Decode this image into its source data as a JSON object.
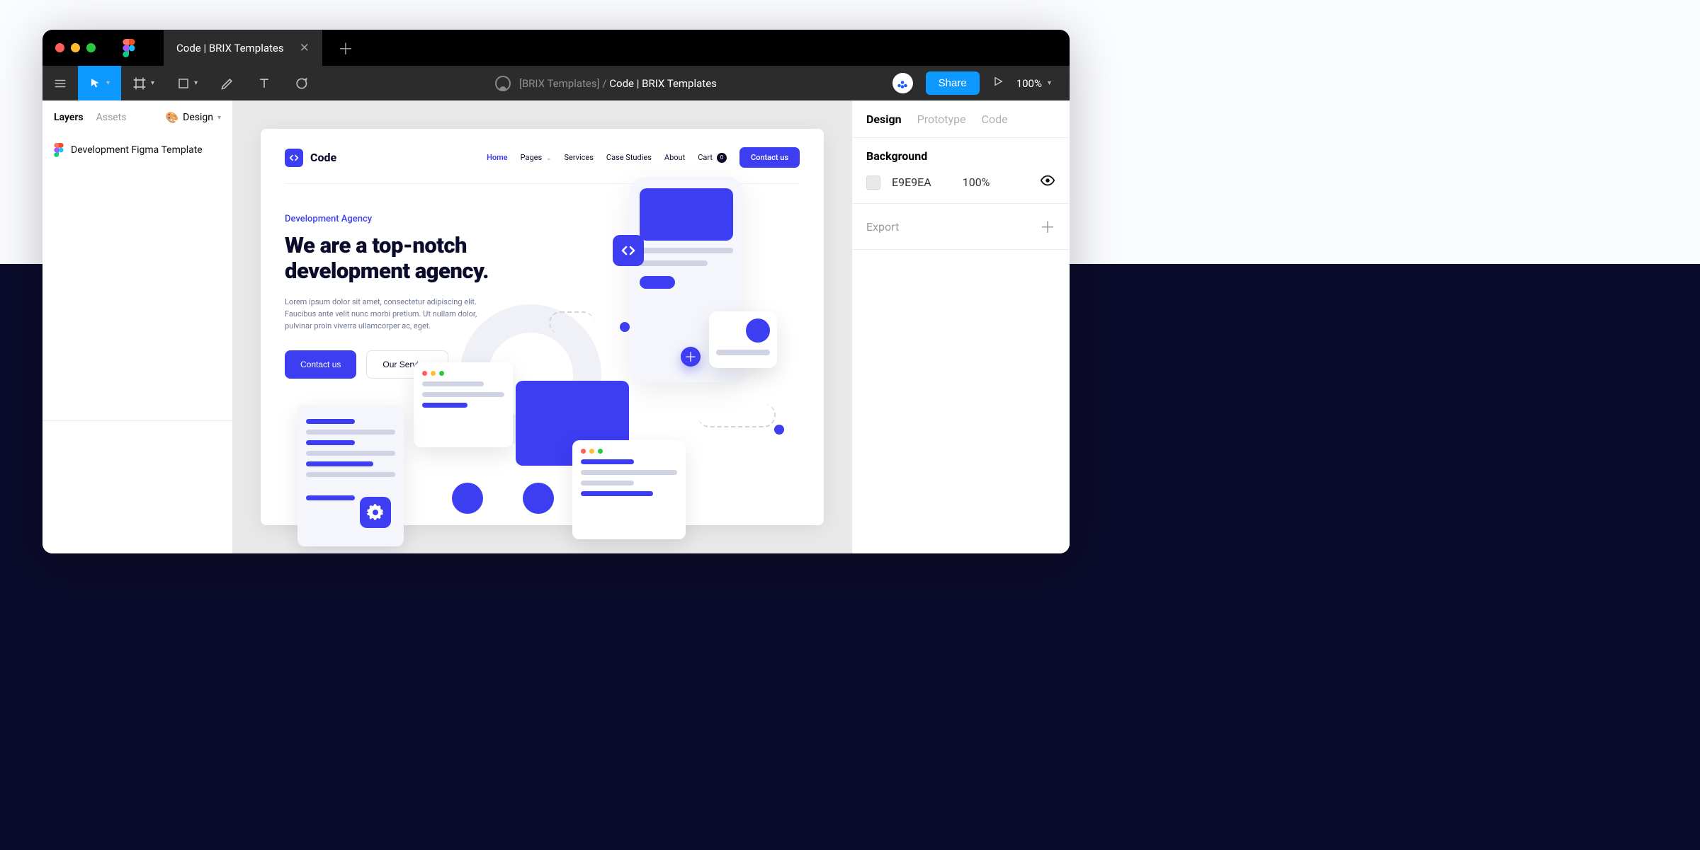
{
  "tab": {
    "title": "Code | BRIX Templates"
  },
  "breadcrumb": {
    "team": "[BRIX Templates]",
    "sep": "/",
    "file": "Code | BRIX Templates"
  },
  "toolbar": {
    "share": "Share",
    "zoom": "100%"
  },
  "left_panel": {
    "tabs": {
      "layers": "Layers",
      "assets": "Assets",
      "design": "Design"
    },
    "layer_name": "Development Figma Template"
  },
  "right_panel": {
    "tabs": {
      "design": "Design",
      "prototype": "Prototype",
      "code": "Code"
    },
    "bg_heading": "Background",
    "bg_hex": "E9E9EA",
    "bg_opacity": "100%",
    "export": "Export"
  },
  "artboard": {
    "brand": "Code",
    "nav": {
      "home": "Home",
      "pages": "Pages",
      "services": "Services",
      "case_studies": "Case Studies",
      "about": "About",
      "cart": "Cart",
      "cart_count": "0",
      "contact": "Contact us"
    },
    "hero": {
      "eyebrow": "Development Agency",
      "headline_l1": "We are a top-notch",
      "headline_l2": "development agency.",
      "body": "Lorem ipsum dolor sit amet, consectetur adipiscing elit. Faucibus ante velit nunc morbi pretium. Ut nullam dolor, pulvinar proin viverra ullamcorper ac, eget.",
      "cta_primary": "Contact us",
      "cta_secondary": "Our Services"
    }
  }
}
